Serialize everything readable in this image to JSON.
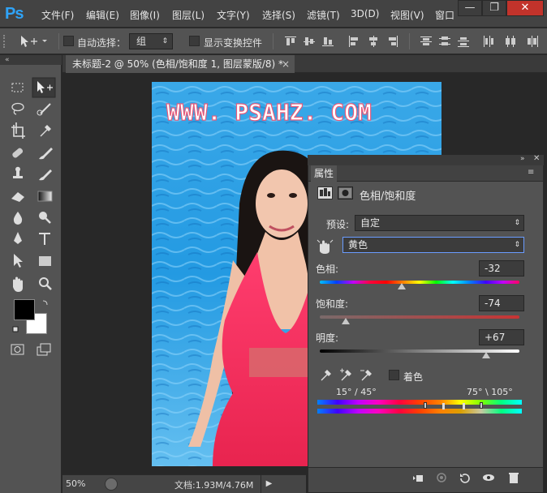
{
  "app": {
    "logo": "Ps"
  },
  "menu": [
    "文件(F)",
    "编辑(E)",
    "图像(I)",
    "图层(L)",
    "文字(Y)",
    "选择(S)",
    "滤镜(T)",
    "3D(D)",
    "视图(V)",
    "窗口"
  ],
  "window_controls": {
    "minimize": "—",
    "restore": "❐",
    "close": "✕"
  },
  "options_bar": {
    "auto_select_label": "自动选择：",
    "auto_select_value": "组",
    "show_transform_label": "显示变换控件"
  },
  "document": {
    "tab_title": "未标题-2 @ 50% (色相/饱和度 1, 图层蒙版/8) *",
    "tab_close": "×",
    "watermark": "WWW. PSAHZ. COM"
  },
  "status": {
    "zoom": "50%",
    "doc_info": "文档:1.93M/4.76M"
  },
  "properties": {
    "tab": "属性",
    "title": "色相/饱和度",
    "preset_label": "预设:",
    "preset_value": "自定",
    "channel_value": "黄色",
    "hue_label": "色相:",
    "hue_value": "-32",
    "hue_level": -32,
    "saturation_label": "饱和度:",
    "saturation_value": "-74",
    "saturation_level": -74,
    "lightness_label": "明度:",
    "lightness_value": "+67",
    "lightness_level": 67,
    "colorize_label": "着色",
    "range_left": "15° / 45°",
    "range_right": "75° \\ 105°"
  },
  "colors": {
    "foreground": "#000000",
    "background": "#ffffff",
    "accent": "#2fa3f7"
  }
}
